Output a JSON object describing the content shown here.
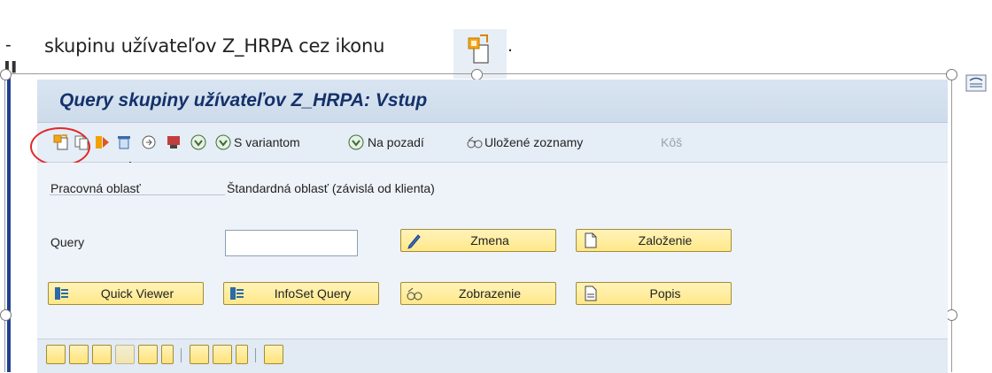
{
  "document": {
    "bullet": "-",
    "instruction": "skupinu užívateľov  Z_HRPA cez ikonu",
    "period": ".",
    "icon": "create-query-icon"
  },
  "window": {
    "title": "Query skupiny užívateľov Z_HRPA: Vstup"
  },
  "toolbar": {
    "variant_label": "S variantom",
    "background_label": "Na pozadí",
    "saved_lists_label": "Uložené zoznamy",
    "bin_label": "Kôš"
  },
  "form": {
    "workspace_label": "Pracovná oblasť",
    "workspace_value": "Štandardná oblasť (závislá od klienta)",
    "query_label": "Query",
    "query_value": ""
  },
  "buttons": {
    "change": "Zmena",
    "create": "Založenie",
    "quick_viewer": "Quick Viewer",
    "infoset_query": "InfoSet Query",
    "display": "Zobrazenie",
    "description": "Popis"
  },
  "colors": {
    "title_text": "#14316a",
    "highlight": "#e32727",
    "button_fill": "#ffe88a"
  }
}
